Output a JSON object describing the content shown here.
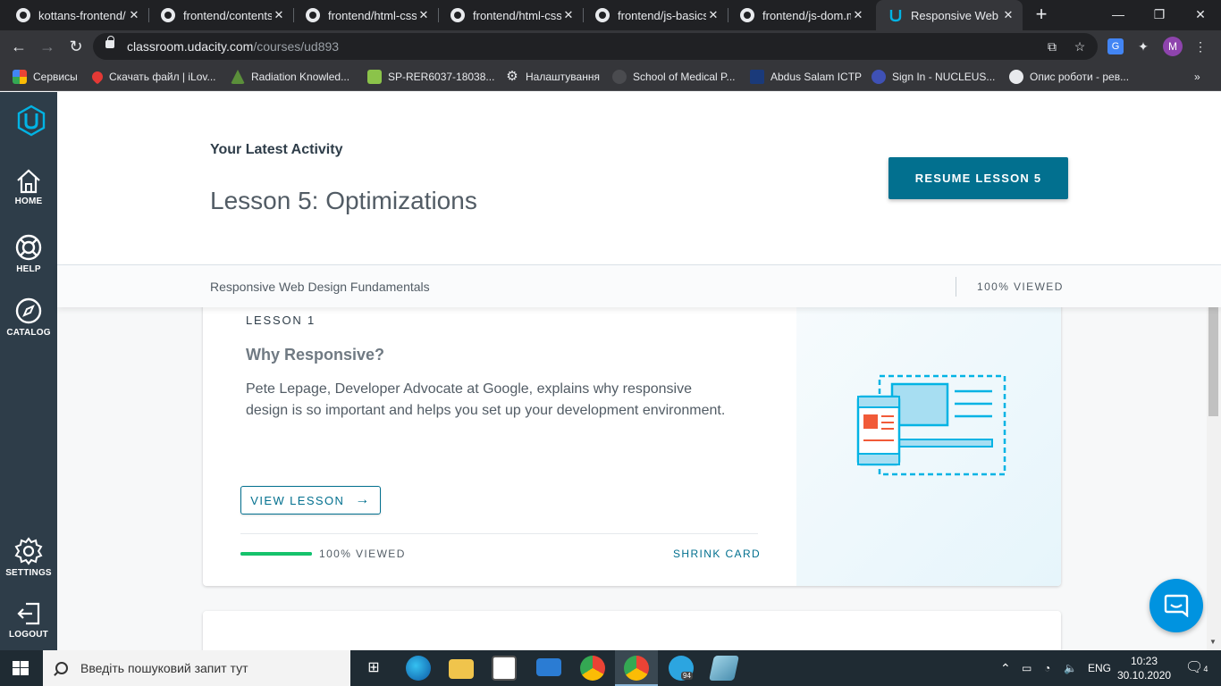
{
  "browser": {
    "tabs": [
      {
        "title": "kottans-frontend/",
        "active": false
      },
      {
        "title": "frontend/contents",
        "active": false
      },
      {
        "title": "frontend/html-css",
        "active": false
      },
      {
        "title": "frontend/html-css",
        "active": false
      },
      {
        "title": "frontend/js-basics",
        "active": false
      },
      {
        "title": "frontend/js-dom.m",
        "active": false
      },
      {
        "title": "Responsive Web D",
        "active": true
      }
    ],
    "url_host": "classroom.udacity.com",
    "url_path": "/courses/ud893",
    "profile_initial": "M",
    "bookmarks": [
      {
        "label": "Сервисы",
        "icon": "apps-grid-icon"
      },
      {
        "label": "Скачать файл | iLov...",
        "icon": "heart-icon"
      },
      {
        "label": "Radiation Knowled...",
        "icon": "radiation-icon"
      },
      {
        "label": "SP-RER6037-18038...",
        "icon": "sheet-icon"
      },
      {
        "label": "Налаштування",
        "icon": "gear-icon"
      },
      {
        "label": "School of Medical P...",
        "icon": "globe-icon"
      },
      {
        "label": "Abdus Salam ICTP",
        "icon": "ictp-icon"
      },
      {
        "label": "Sign In - NUCLEUS...",
        "icon": "nucleus-icon"
      },
      {
        "label": "Опис роботи - рев...",
        "icon": "globe-icon"
      }
    ]
  },
  "sidebar": {
    "items": [
      {
        "label": "HOME",
        "icon": "home-icon"
      },
      {
        "label": "HELP",
        "icon": "lifebuoy-icon"
      },
      {
        "label": "CATALOG",
        "icon": "compass-icon"
      },
      {
        "label": "SETTINGS",
        "icon": "gear-icon"
      },
      {
        "label": "LOGOUT",
        "icon": "logout-icon"
      }
    ]
  },
  "header": {
    "latest_label": "Your Latest Activity",
    "lesson_title": "Lesson 5: Optimizations",
    "resume_button": "RESUME LESSON 5",
    "course_name": "Responsive Web Design Fundamentals",
    "course_viewed": "100% VIEWED"
  },
  "lesson_card": {
    "number_label": "LESSON 1",
    "title": "Why Responsive?",
    "description": "Pete Lepage, Developer Advocate at Google, explains why responsive design is so important and helps you set up your development environment.",
    "view_button": "VIEW LESSON",
    "progress_fraction": 1.0,
    "progress_label": "100% VIEWED",
    "shrink_label": "SHRINK CARD"
  },
  "taskbar": {
    "search_placeholder": "Введіть пошуковий запит тут",
    "language": "ENG",
    "time": "10:23",
    "date": "30.10.2020",
    "notifications": "4",
    "telegram_badge": "94"
  },
  "colors": {
    "udacity_dark": "#2e3d49",
    "accent": "#02708f",
    "udacity_blue": "#02b3e4",
    "progress_green": "#15c26b"
  }
}
